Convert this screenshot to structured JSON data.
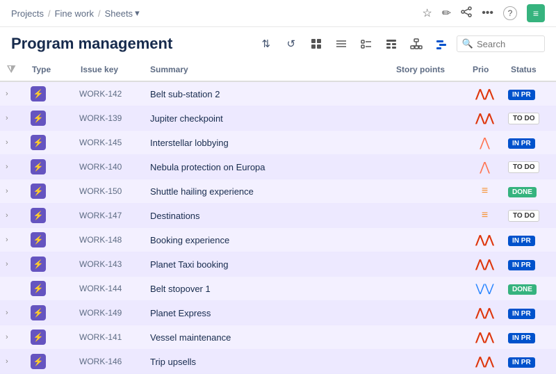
{
  "breadcrumb": {
    "projects": "Projects",
    "sep1": "/",
    "fine_work": "Fine work",
    "sep2": "/",
    "sheets": "Sheets",
    "dropdown_icon": "▾"
  },
  "top_icons": [
    "☆",
    "✏",
    "⋯⋯",
    "?",
    "≡"
  ],
  "page_title": "Program management",
  "toolbar": {
    "icons": [
      "⇅",
      "↺",
      "⊡",
      "≡",
      "☑",
      "⊞",
      "⊥",
      "⊟",
      "⌽"
    ],
    "search_placeholder": "Search"
  },
  "table": {
    "columns": {
      "filter": "",
      "type": "Type",
      "issue_key": "Issue key",
      "summary": "Summary",
      "story_points": "Story points",
      "prio": "Prio",
      "status": "Status"
    },
    "rows": [
      {
        "key": "WORK-142",
        "summary": "Belt sub-station 2",
        "points": "",
        "prio": "critical",
        "prio_icon": "⬆⬆",
        "status": "IN PR",
        "status_type": "inprogress",
        "expand": true
      },
      {
        "key": "WORK-139",
        "summary": "Jupiter checkpoint",
        "points": "",
        "prio": "critical",
        "prio_icon": "⬆⬆",
        "status": "TO DO",
        "status_type": "todo",
        "expand": true
      },
      {
        "key": "WORK-145",
        "summary": "Interstellar lobbying",
        "points": "",
        "prio": "high",
        "prio_icon": "⬆",
        "status": "IN PR",
        "status_type": "inprogress",
        "expand": true
      },
      {
        "key": "WORK-140",
        "summary": "Nebula protection on Europa",
        "points": "",
        "prio": "high",
        "prio_icon": "⬆",
        "status": "TO DO",
        "status_type": "todo",
        "expand": true
      },
      {
        "key": "WORK-150",
        "summary": "Shuttle hailing experience",
        "points": "",
        "prio": "medium",
        "prio_icon": "=",
        "status": "DONE",
        "status_type": "done",
        "expand": true
      },
      {
        "key": "WORK-147",
        "summary": "Destinations",
        "points": "",
        "prio": "medium",
        "prio_icon": "=",
        "status": "TO DO",
        "status_type": "todo",
        "expand": true
      },
      {
        "key": "WORK-148",
        "summary": "Booking experience",
        "points": "",
        "prio": "critical",
        "prio_icon": "⬆⬆",
        "status": "IN PR",
        "status_type": "inprogress",
        "expand": true
      },
      {
        "key": "WORK-143",
        "summary": "Planet Taxi booking",
        "points": "",
        "prio": "critical",
        "prio_icon": "⬆⬆",
        "status": "IN PR",
        "status_type": "inprogress",
        "expand": true
      },
      {
        "key": "WORK-144",
        "summary": "Belt stopover 1",
        "points": "",
        "prio": "low",
        "prio_icon": "⬇⬇",
        "status": "DONE",
        "status_type": "done",
        "expand": false
      },
      {
        "key": "WORK-149",
        "summary": "Planet Express",
        "points": "",
        "prio": "critical",
        "prio_icon": "⬆⬆",
        "status": "IN PR",
        "status_type": "inprogress",
        "expand": true
      },
      {
        "key": "WORK-141",
        "summary": "Vessel maintenance",
        "points": "",
        "prio": "critical",
        "prio_icon": "⬆⬆",
        "status": "IN PR",
        "status_type": "inprogress",
        "expand": true
      },
      {
        "key": "WORK-146",
        "summary": "Trip upsells",
        "points": "",
        "prio": "critical",
        "prio_icon": "⬆⬆",
        "status": "IN PR",
        "status_type": "inprogress",
        "expand": true
      }
    ]
  }
}
